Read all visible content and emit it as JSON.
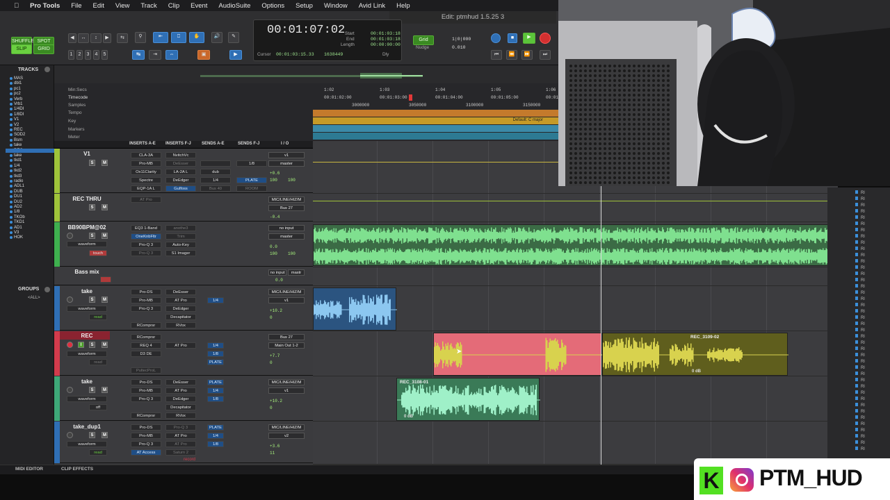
{
  "menubar": {
    "apple": "",
    "app": "Pro Tools",
    "items": [
      "File",
      "Edit",
      "View",
      "Track",
      "Clip",
      "Event",
      "AudioSuite",
      "Options",
      "Setup",
      "Window",
      "Avid Link",
      "Help"
    ]
  },
  "window": {
    "title": "Edit: ptmhud 1.5.25 3"
  },
  "toolbar": {
    "shuffle": "SHUFFLE",
    "spot": "SPOT",
    "slip": "SLIP",
    "grid": "GRID",
    "zoom_presets": [
      "1",
      "2",
      "3",
      "4",
      "5"
    ],
    "main_counter": "00:01:07:02",
    "start_label": "Start",
    "end_label": "End",
    "length_label": "Length",
    "start_val": "00:01:03:18",
    "end_val": "00:01:03:18",
    "length_val": "00:00:00:00",
    "cursor_label": "Cursor",
    "cursor_val": "00:01:03:15.33",
    "samples_val": "1638449",
    "dly_label": "Dly",
    "grid_label": "Grid",
    "grid_val": "1|0|000",
    "nudge_label": "Nudge",
    "nudge_val": "0.010"
  },
  "tracks_panel": {
    "title": "TRACKS",
    "items": [
      "MAS",
      "dbl1",
      "pc1",
      "pc2",
      "Verb",
      "Vrb1",
      "1/4DI",
      "1/8DI",
      "V1",
      "V2",
      "REC",
      "SOD2",
      "Bsm",
      "take",
      "REC",
      "take",
      "tkd1",
      "1/4",
      "tkd2",
      "tkd3",
      "radio",
      "ADL1",
      "DUB",
      "DU1",
      "DU2",
      "AD2",
      "1/8",
      "TKOb",
      "TKD1",
      "AD1",
      "V3",
      "HOK"
    ]
  },
  "groups_panel": {
    "title": "GROUPS",
    "all": "<ALL>"
  },
  "mix_header": {
    "inserts_ae": "INSERTS A-E",
    "inserts_fj": "INSERTS F-J",
    "sends_ae": "SENDS A-E",
    "sends_fj": "SENDS F-J",
    "io": "I / O"
  },
  "rulers": {
    "minsecs": "Min:Secs",
    "timecode": "Timecode",
    "samples": "Samples",
    "tempo": "Tempo",
    "key": "Key",
    "markers": "Markers",
    "meter": "Meter",
    "min_ticks": [
      "1:02",
      "1:03",
      "1:04",
      "1:05",
      "1:06"
    ],
    "tc_ticks": [
      "00:01:02:00",
      "00:01:03:00",
      "00:01:04:00",
      "00:01:05:00",
      "00:01:06:00"
    ],
    "sample_ticks": [
      "3000000",
      "3050000",
      "3100000",
      "3150000"
    ],
    "key_label": "Default: C major"
  },
  "tracks": [
    {
      "name": "V1",
      "inserts": [
        "CLA-3A",
        "Pro-MB",
        "Ox11Clarity",
        "Spectre",
        "EQP-1A L"
      ],
      "inserts2": [
        "NvitchVc",
        "DeEsser",
        "LA-2A L",
        "DeEdger",
        "Gulfoss"
      ],
      "sends": [
        "dub",
        "1/4",
        "Bus 40"
      ],
      "sends2": [
        "1/8",
        "PLATE",
        "ROOM"
      ],
      "io": [
        "v1",
        "master"
      ],
      "vol": "+0.6",
      "pan": "100",
      "pan2": "100",
      "pre": "pre"
    },
    {
      "name": "REC THRU",
      "inserts": [
        "AT Pro"
      ],
      "io": [
        "MIC/LINE/HIZ/M",
        "Bus 27"
      ],
      "vol": "-0.4"
    },
    {
      "name": "BB90BPM@02",
      "inserts": [
        "EQ3 1-Band",
        "OneKnbFltr",
        "Pro-Q 3",
        "Pro-Q 3"
      ],
      "inserts2": [
        "anothe3",
        "Trim",
        "Auto-Key",
        "S1 Imager"
      ],
      "io": [
        "no input",
        "master"
      ],
      "vol": "0.0",
      "pan": "100",
      "pan2": "100",
      "mode": "waveform",
      "auto": "touch"
    },
    {
      "name": "Bass mix",
      "io": [
        "no input",
        "mastr"
      ],
      "vol": "0.0"
    },
    {
      "name": "take",
      "inserts": [
        "Pro-DS",
        "Pro-MB",
        "Pro-Q 3",
        "RComprsr"
      ],
      "inserts2": [
        "DeEsser",
        "AT Pro",
        "DeEdger",
        "Decapitator",
        "RVox"
      ],
      "sends": [
        "1/4"
      ],
      "io": [
        "MIC/LINE/HIZ/M",
        "v1"
      ],
      "vol": "+10.2",
      "pan": "0",
      "mode": "waveform",
      "auto": "read"
    },
    {
      "name": "REC",
      "inserts": [
        "RComprsr",
        "REQ 4",
        "D3 DE"
      ],
      "inserts2": [
        "AT Pro"
      ],
      "sends": [
        "1/4",
        "1/8",
        "PLATE"
      ],
      "io": [
        "Bus 27",
        "Main Out 1-2"
      ],
      "vol": "+7.7",
      "pan": "0",
      "mode": "waveform",
      "auto": "read",
      "extra": "PultecProL"
    },
    {
      "name": "take",
      "inserts": [
        "Pro-DS",
        "Pro-MB",
        "Pro-Q 3",
        "RComprsr"
      ],
      "inserts2": [
        "DeEsser",
        "AT Pro",
        "DeEdger",
        "Decapitator",
        "RVox"
      ],
      "sends": [
        "PLATE",
        "1/4",
        "1/8"
      ],
      "io": [
        "MIC/LINE/HIZ/M",
        "v1"
      ],
      "vol": "+10.2",
      "pan": "0",
      "mode": "waveform",
      "auto": "off"
    },
    {
      "name": "take_dup1",
      "inserts": [
        "Pro-DS",
        "Pro-MB",
        "Pro-Q 3",
        "AT Access"
      ],
      "inserts2": [
        "Pro-Q 3",
        "AT Pro",
        "AT Pro",
        "Saturn 2"
      ],
      "sends": [
        "PLATE",
        "1/4",
        "1/8"
      ],
      "io": [
        "MIC/LINE/HIZ/M",
        "v2"
      ],
      "vol": "+3.6",
      "pan": "11",
      "mode": "waveform",
      "auto": "read",
      "rec_label": "record"
    }
  ],
  "clips": {
    "rec_a": "REC_3109-02",
    "rec_b": "REC_3108-01",
    "gain_a": "0 dB",
    "gain_b": "0 dB"
  },
  "bottom": {
    "midi_editor": "MIDI EDITOR",
    "clip_effects": "CLIP EFFECTS"
  },
  "social": {
    "handle": "PTM_HUD",
    "k": "K"
  },
  "colors": {
    "green_wave": "#5fd07a",
    "blue_clip": "#2f5f8f",
    "rec_pink": "#e87580",
    "olive": "#6b6a1f",
    "green_clip": "#3c8a5a"
  }
}
